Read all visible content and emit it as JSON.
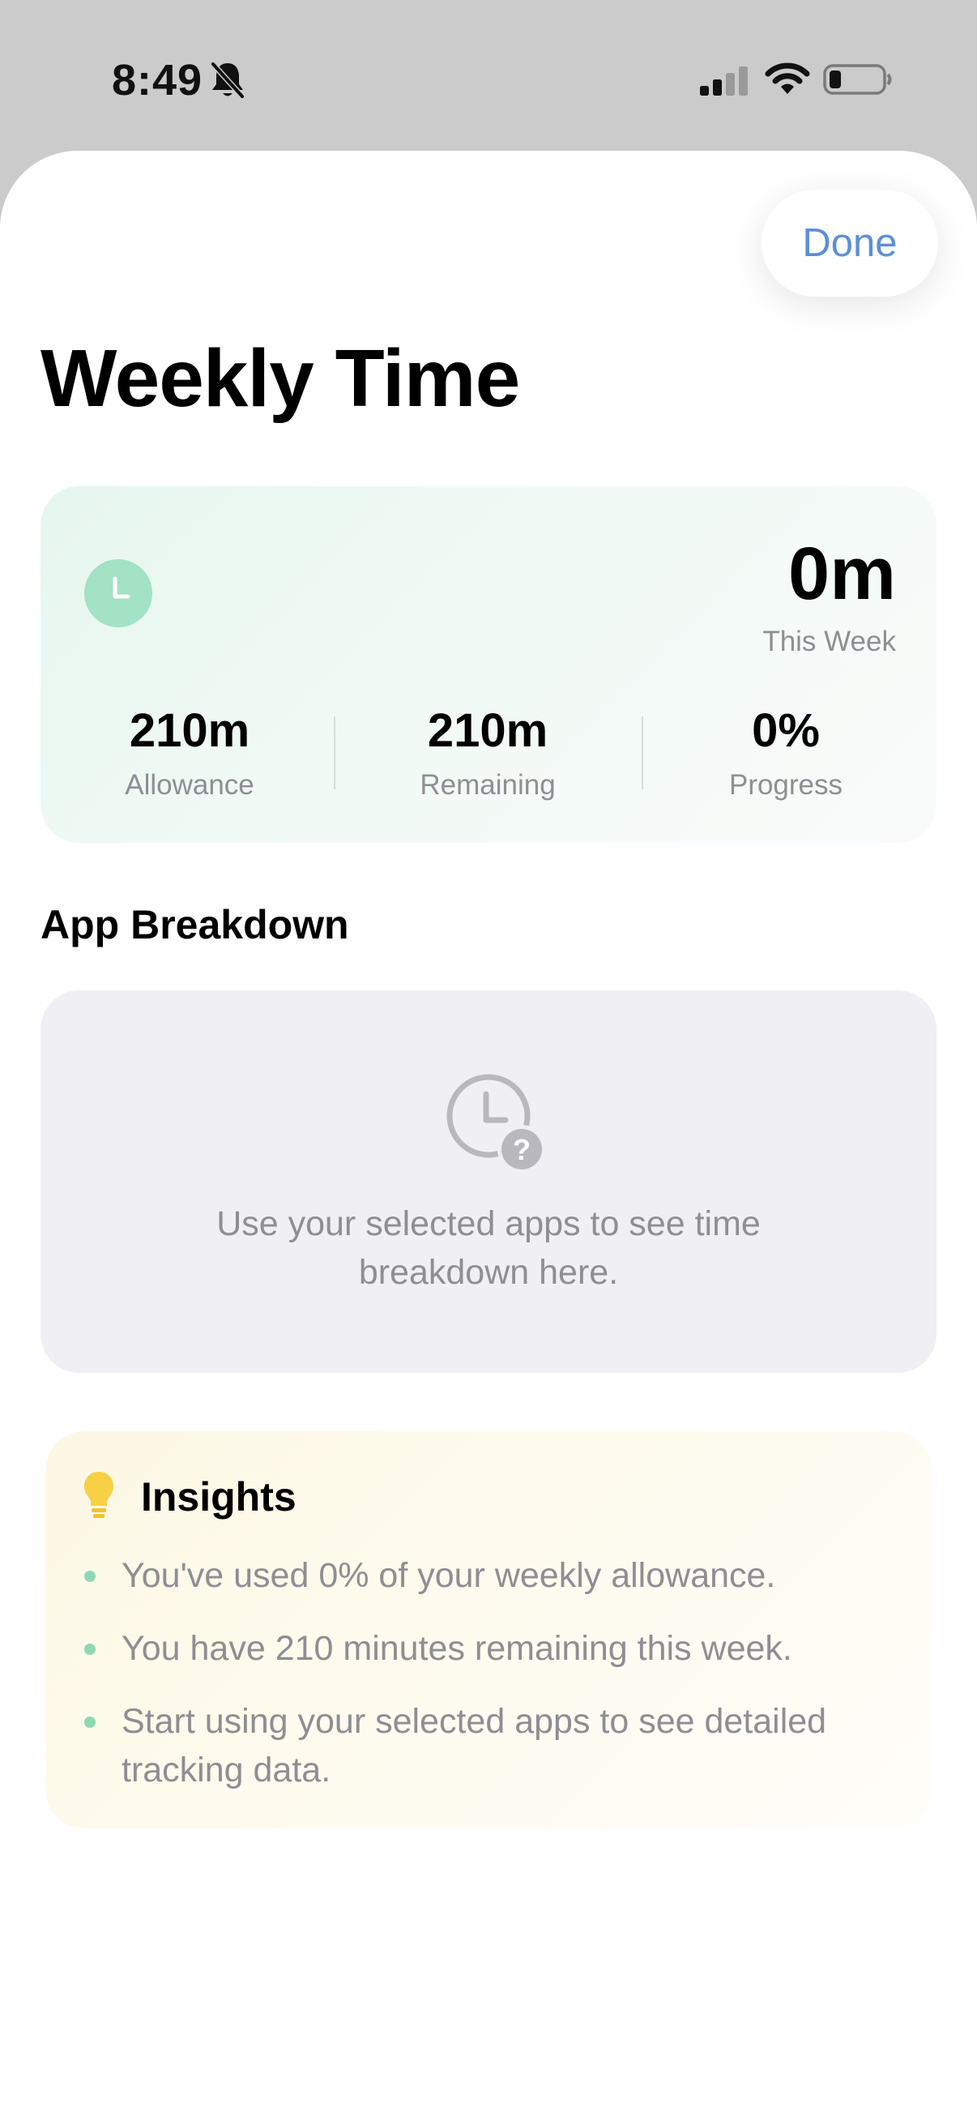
{
  "status_bar": {
    "time": "8:49",
    "icons": [
      "bell-slash-icon",
      "cellular-signal-icon",
      "wifi-icon",
      "battery-icon"
    ]
  },
  "header": {
    "done_label": "Done",
    "title": "Weekly Time"
  },
  "summary": {
    "icon": "clock-icon",
    "week_total": "0m",
    "week_label": "This Week",
    "stats": [
      {
        "value": "210m",
        "label": "Allowance"
      },
      {
        "value": "210m",
        "label": "Remaining"
      },
      {
        "value": "0%",
        "label": "Progress"
      }
    ]
  },
  "breakdown": {
    "title": "App Breakdown",
    "empty_icon": "clock-question-icon",
    "empty_line1": "Use your selected apps to see time",
    "empty_line2": "breakdown here."
  },
  "insights": {
    "icon": "lightbulb-icon",
    "title": "Insights",
    "items": [
      "You've used 0% of your weekly allowance.",
      "You have 210 minutes remaining this week.",
      "Start using your selected apps to see detailed tracking data."
    ]
  },
  "colors": {
    "accent_blue": "#5b8fd8",
    "mint": "#a3e2c4",
    "bullet_green": "#8fd8b5",
    "bulb_yellow": "#f7d046",
    "muted_text": "#8e8e93"
  }
}
